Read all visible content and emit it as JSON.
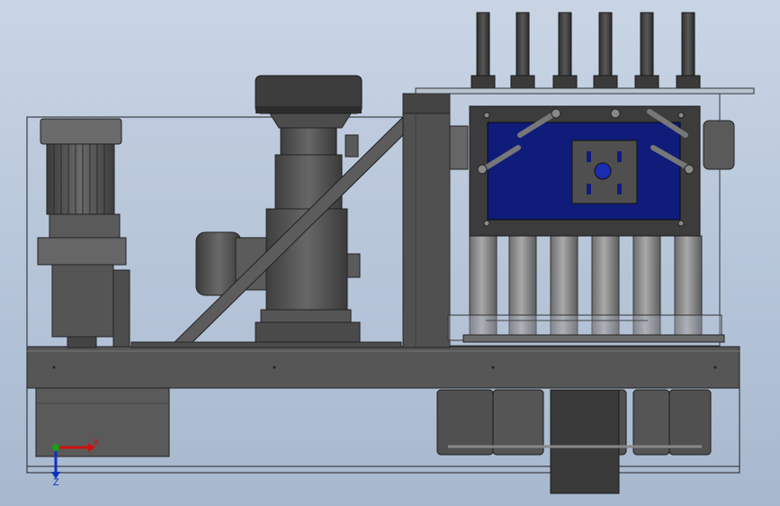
{
  "viewport": {
    "background_top": "#c9d5e5",
    "background_bottom": "#a7b8ce"
  },
  "triad": {
    "x_label": "X",
    "z_label": "Z",
    "x_color": "#d01010",
    "y_color": "#18a018",
    "z_color": "#1030c0"
  },
  "colors": {
    "body_dark": "#4a4a4a",
    "body_mid": "#5e5e5e",
    "body_light": "#777777",
    "frame_line": "#2a2a2a",
    "panel_blue": "#0f1c7a",
    "glass": "#b7c5d8"
  }
}
